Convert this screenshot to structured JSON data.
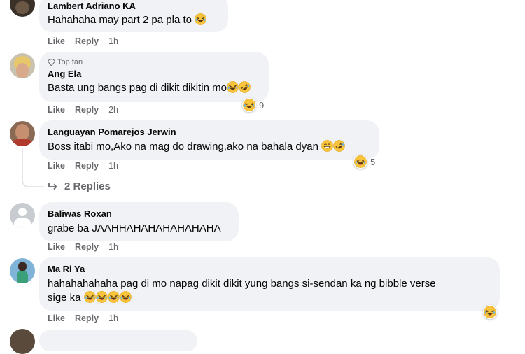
{
  "comments": [
    {
      "author": "Lambert Adriano KA",
      "text": "Hahahaha may part 2 pa pla to",
      "like": "Like",
      "reply": "Reply",
      "time": "1h"
    },
    {
      "badge": "Top fan",
      "author": "Ang Ela",
      "text": "Basta ung bangs pag di dikit dikitin mo",
      "like": "Like",
      "reply": "Reply",
      "time": "2h",
      "reaction_count": "9"
    },
    {
      "author": "Languayan Pomarejos Jerwin",
      "text": "Boss itabi mo,Ako na mag do drawing,ako na bahala dyan",
      "like": "Like",
      "reply": "Reply",
      "time": "1h",
      "reaction_count": "5",
      "replies_label": "2 Replies"
    },
    {
      "author": "Baliwas Roxan",
      "text": "grabe ba JAAHHAHAHAHAHAHAHA",
      "like": "Like",
      "reply": "Reply",
      "time": "1h"
    },
    {
      "author": "Ma Ri Ya",
      "text_line1": "hahahahahaha pag di mo napag dikit dikit yung bangs si-sendan ka ng bibble verse",
      "text_line2": "sige ka",
      "like": "Like",
      "reply": "Reply",
      "time": "1h"
    }
  ],
  "icons": {
    "laugh_emoji": "face-with-tears-of-joy",
    "rofl_emoji": "rolling-on-floor-laughing",
    "grin_emoji": "grinning-face",
    "reply_arrow": "reply-arrow-icon"
  },
  "colors": {
    "bubble": "#f0f2f5",
    "secondary_text": "#65676b",
    "emoji": "#f7b125"
  }
}
